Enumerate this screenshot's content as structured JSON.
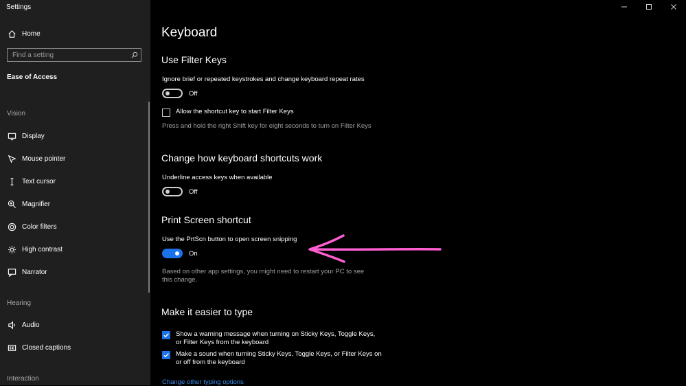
{
  "app": {
    "title": "Settings"
  },
  "sidebar": {
    "home_label": "Home",
    "search_placeholder": "Find a setting",
    "category": "Ease of Access",
    "sections": {
      "vision": "Vision",
      "hearing": "Hearing",
      "interaction": "Interaction"
    },
    "vision_items": [
      {
        "label": "Display",
        "icon": "display-icon"
      },
      {
        "label": "Mouse pointer",
        "icon": "mouse-pointer-icon"
      },
      {
        "label": "Text cursor",
        "icon": "text-cursor-icon"
      },
      {
        "label": "Magnifier",
        "icon": "magnifier-icon"
      },
      {
        "label": "Color filters",
        "icon": "color-filters-icon"
      },
      {
        "label": "High contrast",
        "icon": "high-contrast-icon"
      },
      {
        "label": "Narrator",
        "icon": "narrator-icon"
      }
    ],
    "hearing_items": [
      {
        "label": "Audio",
        "icon": "audio-icon"
      },
      {
        "label": "Closed captions",
        "icon": "closed-captions-icon"
      }
    ]
  },
  "main": {
    "title": "Keyboard",
    "filter_keys": {
      "heading": "Use Filter Keys",
      "description": "Ignore brief or repeated keystrokes and change keyboard repeat rates",
      "toggle_state": "Off",
      "checkbox_label": "Allow the shortcut key to start Filter Keys",
      "hint": "Press and hold the right Shift key for eight seconds to turn on Filter Keys"
    },
    "shortcuts": {
      "heading": "Change how keyboard shortcuts work",
      "description": "Underline access keys when available",
      "toggle_state": "Off"
    },
    "print_screen": {
      "heading": "Print Screen shortcut",
      "description": "Use the PrtScn button to open screen snipping",
      "toggle_state": "On",
      "note": "Based on other app settings, you might need to restart your PC to see this change."
    },
    "typing": {
      "heading": "Make it easier to type",
      "option1": "Show a warning message when turning on Sticky Keys, Toggle Keys, or Filter Keys from the keyboard",
      "option2": "Make a sound when turning Sticky Keys, Toggle Keys, or Filter Keys on or off from the keyboard",
      "link": "Change other typing options"
    }
  },
  "colors": {
    "accent": "#1a73e8",
    "annotation": "#ff5fd2",
    "sidebar_bg": "#1f1f1f"
  }
}
